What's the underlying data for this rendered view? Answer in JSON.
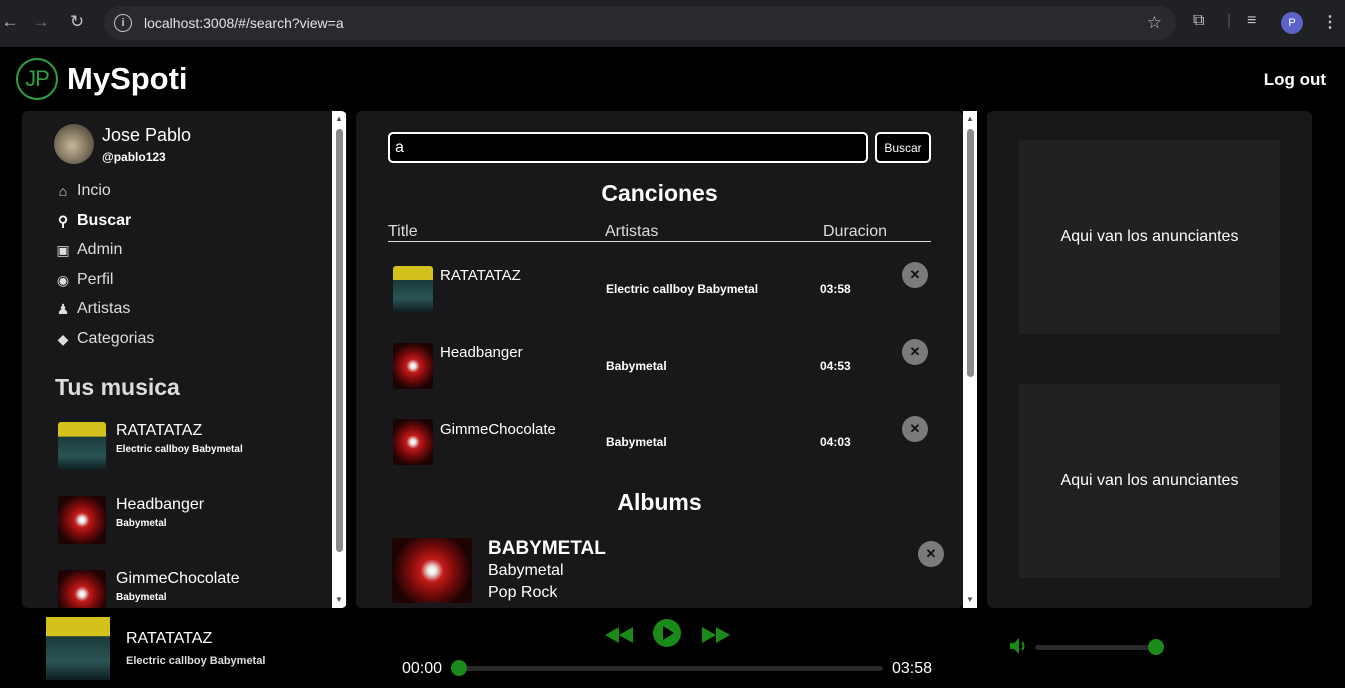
{
  "browser": {
    "url": "localhost:3008/#/search?view=a",
    "profile_initial": "P"
  },
  "header": {
    "logo_text": "JP",
    "brand": "MySpoti",
    "logout_label": "Log out"
  },
  "sidebar": {
    "user_name": "Jose Pablo",
    "user_handle": "@pablo123",
    "nav": [
      {
        "label": "Incio",
        "icon": "home-icon"
      },
      {
        "label": "Buscar",
        "icon": "search-icon",
        "active": true
      },
      {
        "label": "Admin",
        "icon": "briefcase-icon"
      },
      {
        "label": "Perfil",
        "icon": "user-circle-icon"
      },
      {
        "label": "Artistas",
        "icon": "users-icon"
      },
      {
        "label": "Categorias",
        "icon": "tag-icon"
      }
    ],
    "section_title": "Tus musica",
    "songs": [
      {
        "title": "RATATATAZ",
        "artists": "Electric callboy   Babymetal"
      },
      {
        "title": "Headbanger",
        "artists": "Babymetal"
      },
      {
        "title": "GimmeChocolate",
        "artists": "Babymetal"
      }
    ]
  },
  "search": {
    "value": "a",
    "button_label": "Buscar"
  },
  "songs_section": {
    "title": "Canciones",
    "columns": [
      "Title",
      "Artistas",
      "Duracion"
    ],
    "rows": [
      {
        "title": "RATATATAZ",
        "artists": "Electric callboy  Babymetal",
        "duration": "03:58"
      },
      {
        "title": "Headbanger",
        "artists": "Babymetal",
        "duration": "04:53"
      },
      {
        "title": "GimmeChocolate",
        "artists": "Babymetal",
        "duration": "04:03"
      }
    ]
  },
  "albums_section": {
    "title": "Albums",
    "albums": [
      {
        "title": "BABYMETAL",
        "artist": "Babymetal",
        "genres": "Pop  Rock"
      }
    ]
  },
  "ads": {
    "slots": [
      "Aqui van los anunciantes",
      "Aqui van los anunciantes"
    ]
  },
  "player": {
    "title": "RATATATAZ",
    "artists": "Electric callboy  Babymetal",
    "current_time": "00:00",
    "total_time": "03:58",
    "progress": 0,
    "volume": 1.0
  },
  "colors": {
    "accent": "#1a8a1a",
    "panel": "#18181a",
    "ad_box": "#212123"
  }
}
